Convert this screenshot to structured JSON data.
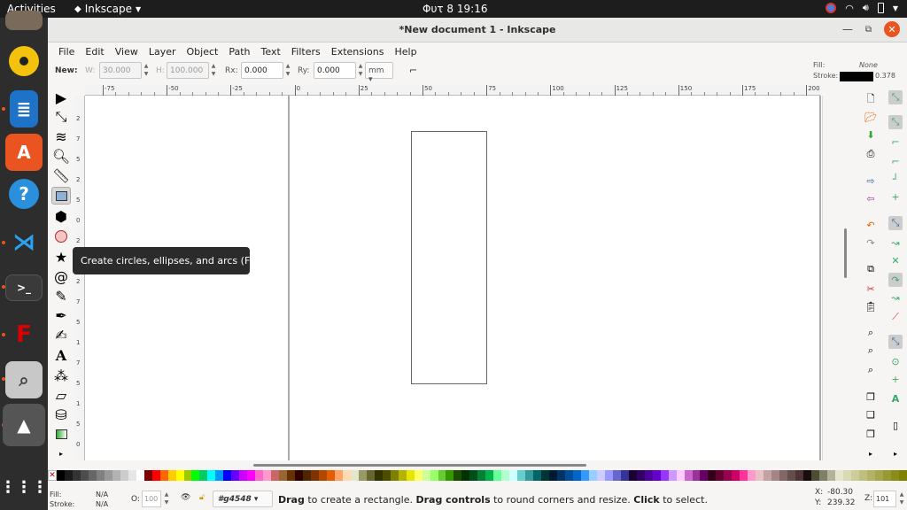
{
  "topbar": {
    "activities": "Activities",
    "app_name": "Inkscape",
    "clock": "Φυτ 8  19:16"
  },
  "window": {
    "title": "*New document 1 - Inkscape"
  },
  "menu": [
    "File",
    "Edit",
    "View",
    "Layer",
    "Object",
    "Path",
    "Text",
    "Filters",
    "Extensions",
    "Help"
  ],
  "tool_controls": {
    "new_label": "New:",
    "w_label": "W:",
    "w_value": "30.000",
    "h_label": "H:",
    "h_value": "100.000",
    "rx_label": "Rx:",
    "rx_value": "0.000",
    "ry_label": "Ry:",
    "ry_value": "0.000",
    "unit": "mm"
  },
  "style_indicator": {
    "fill_label": "Fill:",
    "fill_value": "None",
    "stroke_label": "Stroke:",
    "stroke_width": "0.378"
  },
  "ruler": {
    "h_ticks": [
      "-75",
      "-50",
      "-25",
      "0",
      "25",
      "50",
      "75",
      "100",
      "125",
      "150",
      "175",
      "200"
    ],
    "v_ticks": [
      "2",
      "7",
      "5",
      "2",
      "5",
      "0",
      "2",
      "5",
      "2",
      "7",
      "5",
      "1",
      "7",
      "5",
      "1",
      "5",
      "0"
    ]
  },
  "tooltip": "Create circles, ellipses, and arcs (F5)",
  "status": {
    "fill_label": "Fill:",
    "fill_value": "N/A",
    "stroke_label": "Stroke:",
    "stroke_value": "N/A",
    "opacity_label": "O:",
    "opacity_value": "100",
    "layer": "#g4548",
    "message_parts": [
      "Drag",
      " to create a rectangle. ",
      "Drag controls",
      " to round corners and resize. ",
      "Click",
      " to select."
    ],
    "x_label": "X:",
    "x_value": "-80.30",
    "y_label": "Y:",
    "y_value": "239.32",
    "z_label": "Z:",
    "zoom_value": "101"
  },
  "colors": {
    "accent": "#e95420",
    "palette": [
      "#000000",
      "#1a1a1a",
      "#333333",
      "#4d4d4d",
      "#666666",
      "#808080",
      "#999999",
      "#b3b3b3",
      "#cccccc",
      "#e6e6e6",
      "#ffffff",
      "#800000",
      "#ff0000",
      "#ff6600",
      "#ffcc00",
      "#ffff00",
      "#99cc00",
      "#00ff00",
      "#00cc66",
      "#00ffff",
      "#0099ff",
      "#0000ff",
      "#6600ff",
      "#cc00ff",
      "#ff00ff",
      "#ff66cc",
      "#ff99cc",
      "#cc6666",
      "#996633",
      "#663300",
      "#330000",
      "#4d2600",
      "#803300",
      "#b34700",
      "#e65c00",
      "#ffa366",
      "#ffd9b3",
      "#e6e6cc",
      "#999966",
      "#666633",
      "#333300",
      "#4d4d00",
      "#808000",
      "#b3b300",
      "#e6e600",
      "#ffff66",
      "#ccff99",
      "#99ff66",
      "#66cc33",
      "#339900",
      "#1a4d00",
      "#003300",
      "#004d1a",
      "#008033",
      "#00b34d",
      "#66ff99",
      "#b3ffcc",
      "#ccffff",
      "#66cccc",
      "#339999",
      "#006666",
      "#003333",
      "#001a33",
      "#003366",
      "#004d99",
      "#0066cc",
      "#3399ff",
      "#99ccff",
      "#ccccff",
      "#9999ff",
      "#6666cc",
      "#333399",
      "#1a0033",
      "#330066",
      "#4d0099",
      "#6600cc",
      "#9933ff",
      "#cc99ff",
      "#ffccff",
      "#cc66cc",
      "#993399",
      "#660066",
      "#33001a",
      "#660033",
      "#99004d",
      "#cc0066",
      "#ff3399",
      "#ff99cc",
      "#e6c2c2",
      "#c2a3a3",
      "#a38585",
      "#856666",
      "#664d4d",
      "#4d3333",
      "#1a0d0d",
      "#4d4d33",
      "#808066",
      "#b3b399",
      "#e6e6cc",
      "#d9d9b3",
      "#cccc99",
      "#bfbf80",
      "#b3b366",
      "#a6a64d",
      "#999933",
      "#8c8c1a",
      "#808000"
    ]
  }
}
